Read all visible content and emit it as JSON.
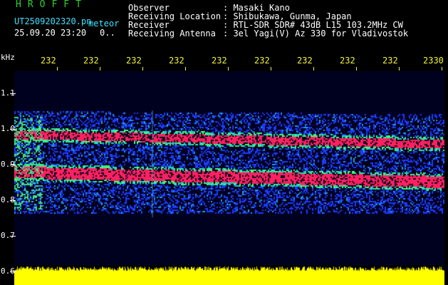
{
  "header": {
    "app": "HROFFT",
    "file": "UT2509202320.pn",
    "mode": "meteor",
    "datetime": "25.09.20 23:20",
    "flag": "0..",
    "rows": [
      {
        "label": "Observer",
        "value": ": Masaki Kano"
      },
      {
        "label": "Receiving Location",
        "value": ": Shibukawa, Gunma, Japan"
      },
      {
        "label": "Receiver",
        "value": ": RTL-SDR SDR# 43dB L15 103.2MHz CW"
      },
      {
        "label": "Receiving Antenna",
        "value": ": 3el Yagi(V) Az 330 for Vladivostok"
      }
    ]
  },
  "y_axis": {
    "unit": "kHz",
    "ticks": [
      "1.1",
      "1.0",
      "0.9",
      "0.8",
      "0.7",
      "0.6"
    ]
  },
  "x_axis": {
    "ticks": [
      "232",
      "232",
      "232",
      "232",
      "232",
      "232",
      "232",
      "232",
      "232",
      "2330"
    ]
  },
  "colors": {
    "background": "#00001f",
    "noise": "#1a3cff",
    "signal": "#ff2060",
    "mid": "#20c0c0",
    "power": "#ffff00"
  }
}
